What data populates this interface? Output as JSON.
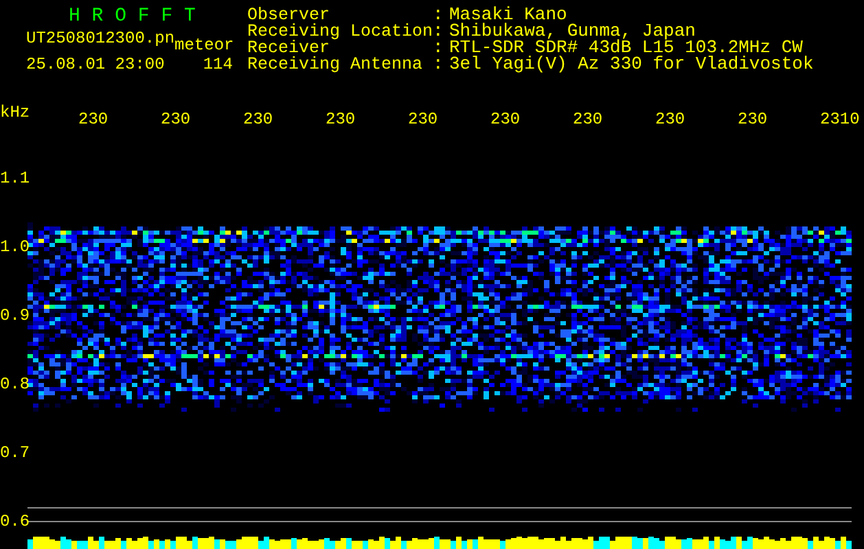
{
  "header": {
    "title": "H R O F F T",
    "file_name": "UT2508012300.pn",
    "tag": "meteor",
    "date_time": "25.08.01 23:00",
    "count": "114"
  },
  "info": [
    {
      "label": "Observer",
      "sep": ":",
      "value": "Masaki Kano"
    },
    {
      "label": "Receiving Location",
      "sep": ":",
      "value": "Shibukawa, Gunma, Japan"
    },
    {
      "label": "Receiver",
      "sep": ":",
      "value": "RTL-SDR SDR# 43dB L15 103.2MHz CW"
    },
    {
      "label": "Receiving Antenna",
      "sep": ":",
      "value": "3el Yagi(V) Az 330 for Vladivostok"
    }
  ],
  "axis": {
    "unit": "kHz",
    "time_labels": [
      "230",
      "230",
      "230",
      "230",
      "230",
      "230",
      "230",
      "230",
      "230",
      "2310"
    ],
    "freq_labels": [
      "1.1",
      "1.0",
      "0.9",
      "0.8",
      "0.7",
      "0.6"
    ]
  }
}
